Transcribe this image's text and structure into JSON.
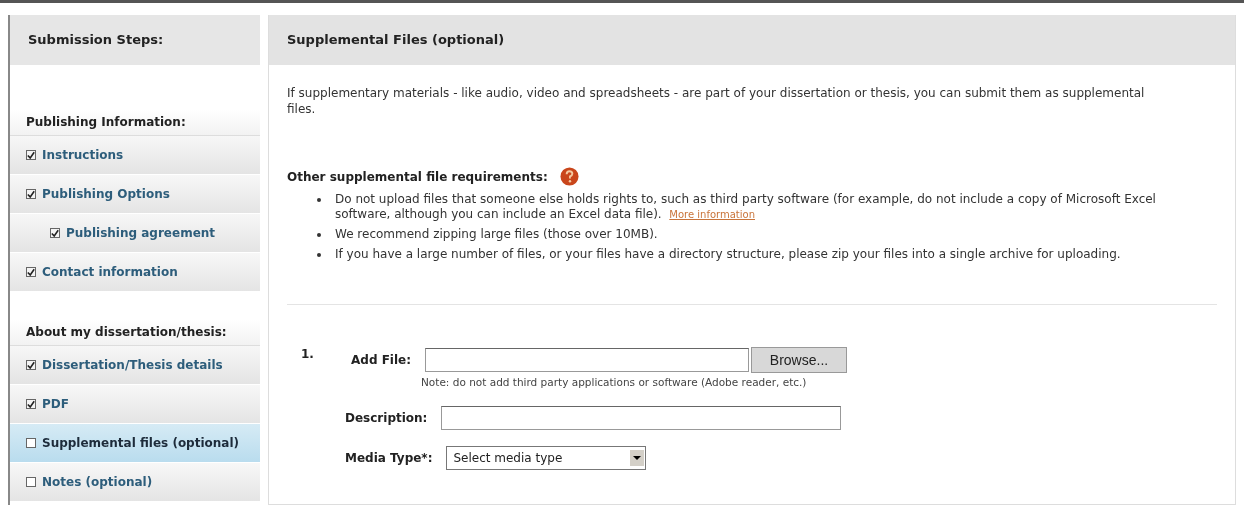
{
  "sidebar": {
    "title": "Submission Steps:",
    "groups": [
      {
        "heading": "Publishing Information:",
        "items": [
          {
            "label": "Instructions",
            "checked": true,
            "selected": false
          },
          {
            "label": "Publishing Options",
            "checked": true,
            "selected": false,
            "children": [
              {
                "label": "Publishing agreement",
                "checked": true,
                "selected": false
              }
            ]
          },
          {
            "label": "Contact information",
            "checked": true,
            "selected": false
          }
        ]
      },
      {
        "heading": "About my dissertation/thesis:",
        "items": [
          {
            "label": "Dissertation/Thesis details",
            "checked": true,
            "selected": false
          },
          {
            "label": "PDF",
            "checked": true,
            "selected": false
          },
          {
            "label": "Supplemental files (optional)",
            "checked": false,
            "selected": true
          },
          {
            "label": "Notes (optional)",
            "checked": false,
            "selected": false
          }
        ]
      }
    ]
  },
  "main": {
    "title": "Supplemental Files (optional)",
    "intro": "If supplementary materials - like audio, video and spreadsheets - are part of your dissertation or thesis, you can submit them as supplemental files.",
    "requirements_heading": "Other supplemental file requirements:",
    "requirements": [
      {
        "text": "Do not upload files that someone else holds rights to, such as third party software (for example, do not include a copy of Microsoft Excel software, although you can include an Excel data file).",
        "link": "More information"
      },
      {
        "text": "We recommend zipping large files (those over 10MB)."
      },
      {
        "text": "If you have a large number of files, or your files have a directory structure, please zip your files into a single archive for uploading."
      }
    ],
    "form": {
      "number": "1.",
      "add_file_label": "Add File:",
      "browse": "Browse...",
      "note": "Note: do not add third party applications or software (Adobe reader, etc.)",
      "description_label": "Description:",
      "media_type_label": "Media Type*:",
      "media_type_value": "Select media type"
    }
  }
}
